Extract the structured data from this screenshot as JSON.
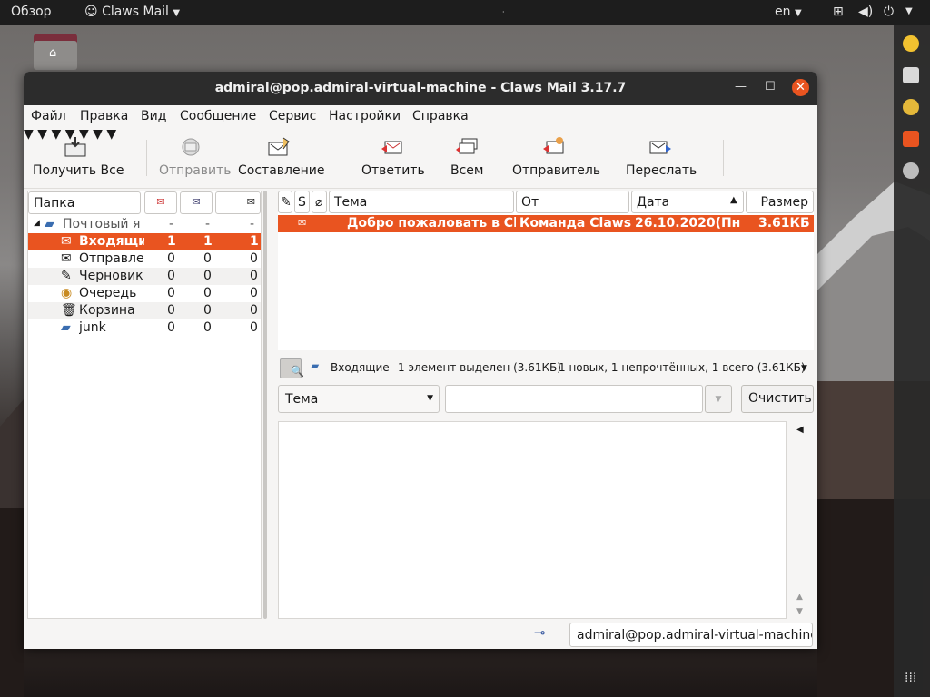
{
  "topbar": {
    "activities": "Обзор",
    "app_name": "Claws Mail",
    "language": "en"
  },
  "window": {
    "title": "admiral@pop.admiral-virtual-machine - Claws Mail 3.17.7"
  },
  "menu": [
    "Файл",
    "Правка",
    "Вид",
    "Сообщение",
    "Сервис",
    "Настройки",
    "Справка"
  ],
  "toolbar": {
    "get_all": "Получить Все",
    "send": "Отправить",
    "compose": "Составление",
    "reply": "Ответить",
    "reply_all": "Всем",
    "reply_sender": "Отправитель",
    "forward": "Переслать"
  },
  "folders": {
    "header": {
      "name": "Папка"
    },
    "mailbox": {
      "name": "Почтовый я",
      "new": "-",
      "unread": "-",
      "total": "-"
    },
    "items": [
      {
        "name": "Входящие",
        "new": "1",
        "unread": "1",
        "total": "1"
      },
      {
        "name": "Отправленные",
        "new": "0",
        "unread": "0",
        "total": "0"
      },
      {
        "name": "Черновики",
        "new": "0",
        "unread": "0",
        "total": "0"
      },
      {
        "name": "Очередь",
        "new": "0",
        "unread": "0",
        "total": "0"
      },
      {
        "name": "Корзина",
        "new": "0",
        "unread": "0",
        "total": "0"
      },
      {
        "name": "junk",
        "new": "0",
        "unread": "0",
        "total": "0"
      }
    ]
  },
  "messages": {
    "headers": {
      "s": "S",
      "subject": "Тема",
      "from": "От",
      "date": "Дата",
      "size": "Размер"
    },
    "rows": [
      {
        "subject": "Добро пожаловать в Claws Mail",
        "from": "Команда Claws Mail",
        "date": "26.10.2020(Пн",
        "size": "3.61КБ"
      }
    ]
  },
  "infobar": {
    "folder": "Входящие",
    "selected": "1 элемент выделен (3.61КБ)",
    "summary": "1 новых, 1 непрочтённых, 1 всего (3.61КБ)"
  },
  "filter": {
    "field": "Тема",
    "value": "",
    "clear": "Очистить"
  },
  "status": {
    "account": "admiral@pop.admiral-virtual-machine"
  }
}
